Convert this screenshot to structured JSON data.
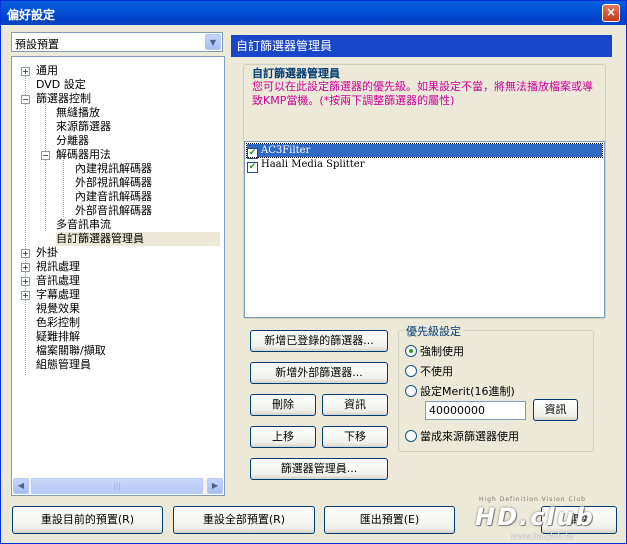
{
  "window": {
    "title": "偏好設定",
    "close_glyph": "×"
  },
  "preset_combo": {
    "value": "預設預置"
  },
  "tree": {
    "items": [
      {
        "label": "通用"
      },
      {
        "label": "DVD 設定"
      },
      {
        "label": "篩選器控制"
      },
      {
        "label": "無縫播放"
      },
      {
        "label": "來源篩選器"
      },
      {
        "label": "分離器"
      },
      {
        "label": "解碼器用法"
      },
      {
        "label": "內建視訊解碼器"
      },
      {
        "label": "外部視訊解碼器"
      },
      {
        "label": "內建音訊解碼器"
      },
      {
        "label": "外部音訊解碼器"
      },
      {
        "label": "多音訊串流"
      },
      {
        "label": "自訂篩選器管理員"
      },
      {
        "label": "外掛"
      },
      {
        "label": "視訊處理"
      },
      {
        "label": "音訊處理"
      },
      {
        "label": "字幕處理"
      },
      {
        "label": "視覺效果"
      },
      {
        "label": "色彩控制"
      },
      {
        "label": "疑難排解"
      },
      {
        "label": "檔案關聯/擷取"
      },
      {
        "label": "組態管理員"
      }
    ],
    "selected": "自訂篩選器管理員"
  },
  "panel": {
    "header": "自訂篩選器管理員",
    "group_title": "自訂篩選器管理員",
    "description": "您可以在此設定篩選器的優先級。如果設定不當，將無法播放檔案或導致KMP當機。(*按兩下調整篩選器的屬性)",
    "filters": [
      {
        "name": "AC3Filter",
        "checked": true,
        "selected": true
      },
      {
        "name": "Haali Media Splitter",
        "checked": true,
        "selected": false
      }
    ],
    "buttons": {
      "add_registered": "新增已登錄的篩選器...",
      "add_external": "新增外部篩選器...",
      "delete": "刪除",
      "info": "資訊",
      "move_up": "上移",
      "move_down": "下移",
      "filter_manager": "篩選器管理員..."
    },
    "priority": {
      "legend": "優先級設定",
      "force": "強制使用",
      "disable": "不使用",
      "set_merit": "設定Merit(16進制)",
      "merit_value": "40000000",
      "merit_info": "資訊",
      "as_source": "當成來源篩選器使用",
      "selected": "強制使用"
    }
  },
  "footer": {
    "reset_current": "重設目前的預置(R)",
    "reset_all": "重設全部預置(R)",
    "export": "匯出預置(E)",
    "close_partial": "關閉"
  },
  "watermark": {
    "top": "High Definition Vision Club",
    "brand": "HD.club",
    "url": "www.hd.club.tw"
  },
  "colors": {
    "header_bg": "#1946c8",
    "desc_text": "#cc0099",
    "title_bar": "#0350d6"
  }
}
